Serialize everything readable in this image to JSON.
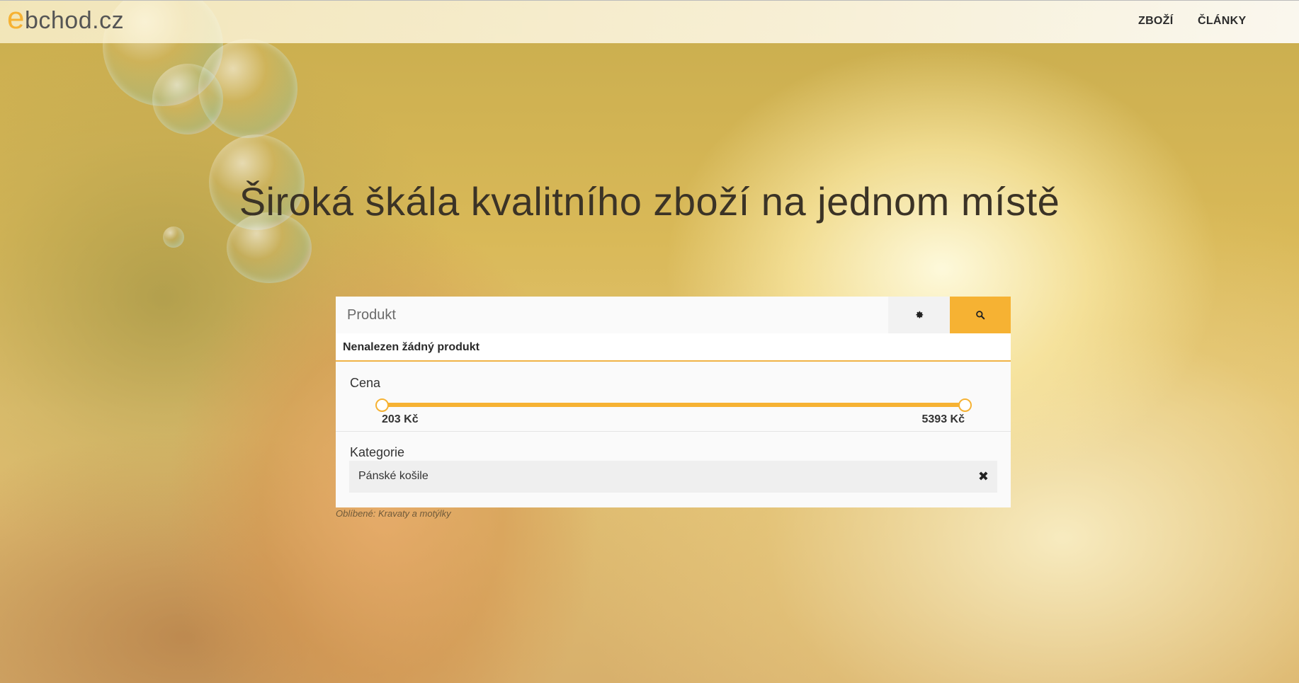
{
  "header": {
    "logo_letter": "e",
    "logo_text": "bchod.cz",
    "nav": [
      {
        "label": "ZBOŽÍ"
      },
      {
        "label": "ČLÁNKY"
      }
    ]
  },
  "hero": {
    "title": "Široká škála kvalitního zboží na jednom místě"
  },
  "search": {
    "placeholder": "Produkt",
    "settings_icon": "gear-icon",
    "search_icon": "search-icon",
    "accent_color": "#f6b233"
  },
  "results": {
    "message": "Nenalezen žádný produkt"
  },
  "filters": {
    "price": {
      "title": "Cena",
      "min_label": "203 Kč",
      "max_label": "5393 Kč"
    },
    "category": {
      "title": "Kategorie",
      "selected": "Pánské košile",
      "remove_icon": "close-icon"
    }
  },
  "popular": {
    "text": "Oblíbené: Kravaty a motýlky"
  }
}
